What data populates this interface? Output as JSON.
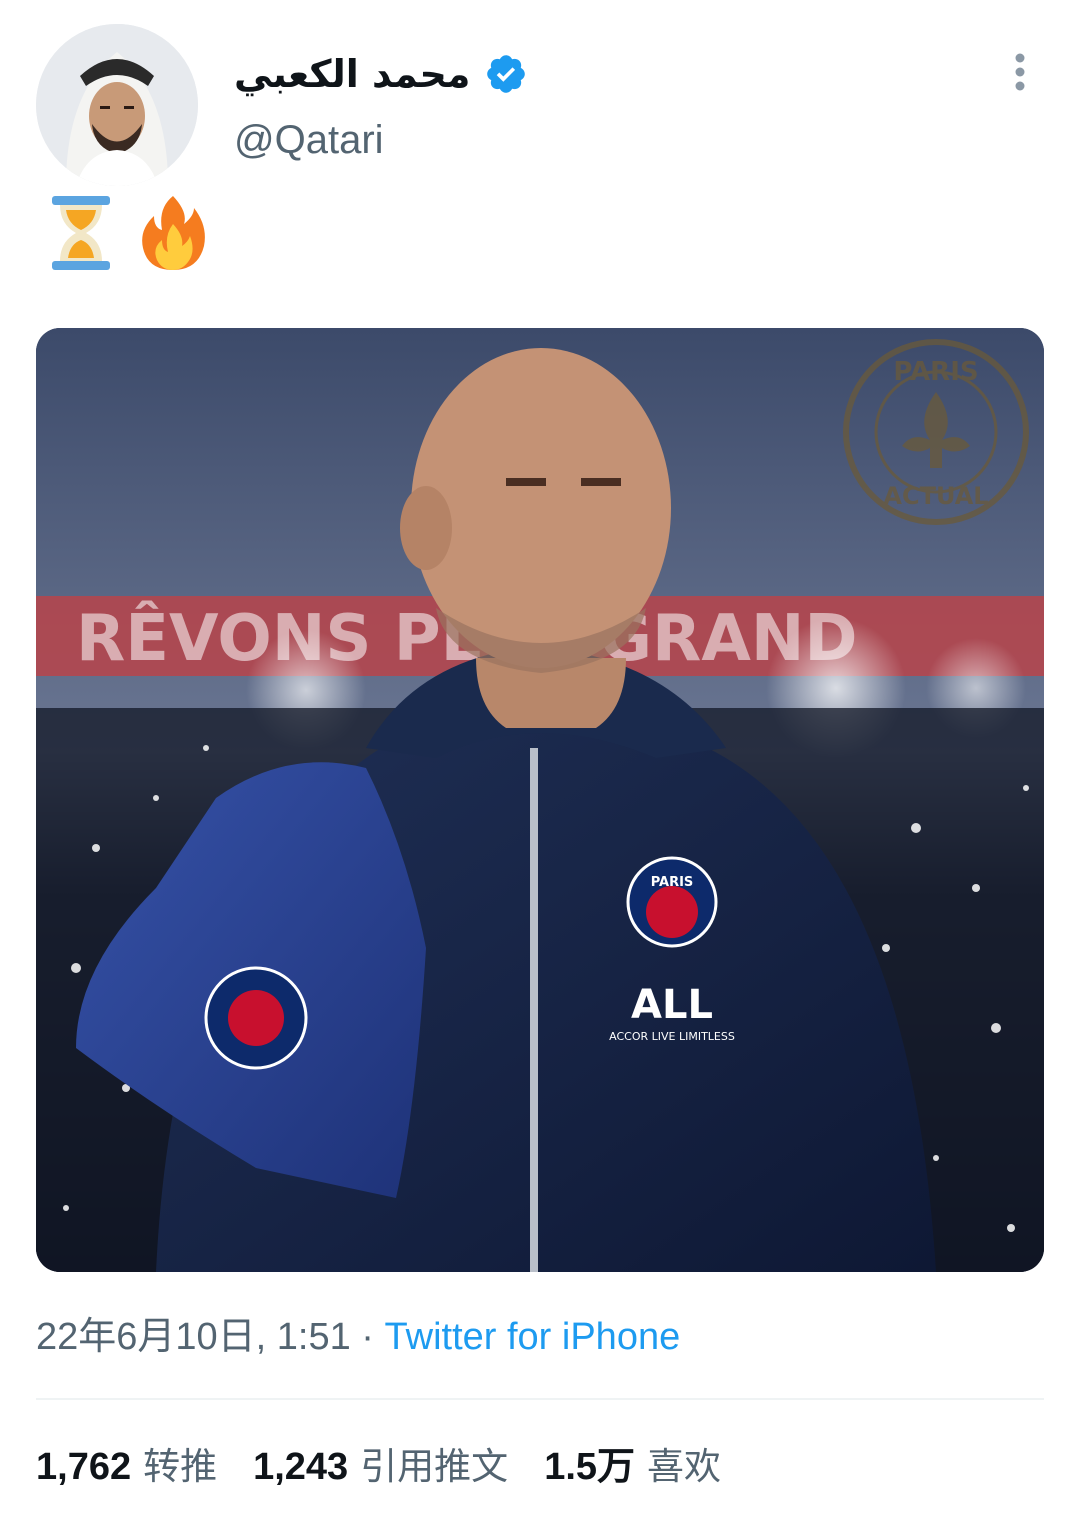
{
  "header": {
    "display_name": "محمد الكعبي",
    "handle": "@Qatari",
    "verified": true
  },
  "tweet": {
    "text": "⏳🔥",
    "emojis": [
      "hourglass-icon",
      "fire-icon"
    ],
    "media": {
      "banner_text": "RÊVONS PLUS GRAND",
      "badge_text_top": "PARIS",
      "badge_text_bottom": "ACTUAL",
      "sponsor_logo": "ALL",
      "sponsor_text": "ACCOR LIVE LIMITLESS",
      "crest_text": "PARIS"
    }
  },
  "meta": {
    "timestamp": "22年6月10日, 1:51",
    "separator": " · ",
    "source": "Twitter for iPhone"
  },
  "stats": {
    "retweets_value": "1,762",
    "retweets_label": "转推",
    "quotes_value": "1,243",
    "quotes_label": "引用推文",
    "likes_value": "1.5万",
    "likes_label": "喜欢"
  },
  "colors": {
    "accent": "#1d9bf0",
    "text_primary": "#0f1419",
    "text_secondary": "#536471",
    "divider": "#eff3f4"
  }
}
